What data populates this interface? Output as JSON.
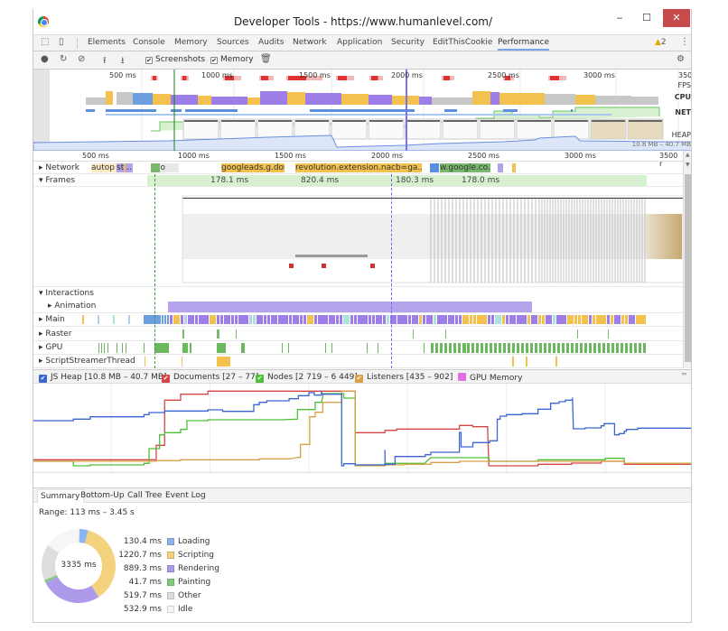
{
  "window": {
    "title": "Developer Tools - https://www.humanlevel.com/",
    "minimize": "‒",
    "maximize": "☐",
    "close": "✕"
  },
  "tabs": [
    {
      "label": "Elements"
    },
    {
      "label": "Console"
    },
    {
      "label": "Memory"
    },
    {
      "label": "Sources"
    },
    {
      "label": "Audits"
    },
    {
      "label": "Network"
    },
    {
      "label": "Application"
    },
    {
      "label": "Security"
    },
    {
      "label": "EditThisCookie"
    },
    {
      "label": "Performance",
      "active": true
    }
  ],
  "warnings": {
    "icon": "warning-icon",
    "count": "2"
  },
  "toolbar": {
    "screenshots_label": "Screenshots",
    "screenshots_checked": true,
    "memory_label": "Memory",
    "memory_checked": true
  },
  "overview": {
    "ticks": [
      "500 ms",
      "1000 ms",
      "1500 ms",
      "2000 ms",
      "2500 ms",
      "3000 ms",
      "3500"
    ],
    "labels": {
      "fps": "FPS",
      "cpu": "CPU",
      "net": "NET",
      "heap": "HEAP"
    },
    "heap_range": "10.8 MB – 40.7 MB"
  },
  "ruler": {
    "ticks": [
      "500 ms",
      "1000 ms",
      "1500 ms",
      "2000 ms",
      "2500 ms",
      "3000 ms",
      "3500 r"
    ]
  },
  "tracks": {
    "network": "Network",
    "frames": "Frames",
    "interactions": "Interactions",
    "animation": "Animation",
    "main": "Main",
    "raster": "Raster",
    "gpu": "GPU",
    "script_streamer": "ScriptStreamerThread"
  },
  "network_items": [
    {
      "label": "autop"
    },
    {
      "label": "st..."
    },
    {
      "label": "ico"
    },
    {
      "label": "googleads.g.doubl"
    },
    {
      "label": "revolution.extension.navigat"
    },
    {
      "label": "cb=ga..."
    },
    {
      "label": "w.google.co..."
    }
  ],
  "frames": [
    {
      "label": "178.1 ms"
    },
    {
      "label": "820.4 ms"
    },
    {
      "label": "180.3 ms"
    },
    {
      "label": "178.0 ms"
    }
  ],
  "memory_legend": [
    {
      "label": "JS Heap [10.8 MB – 40.7 MB]",
      "color": "#3a66d4",
      "checked": true
    },
    {
      "label": "Documents [27 – 77]",
      "color": "#d64545",
      "checked": true
    },
    {
      "label": "Nodes [2 719 – 6 449]",
      "color": "#4fbf3a",
      "checked": true
    },
    {
      "label": "Listeners [435 – 902]",
      "color": "#d8a047",
      "checked": true
    },
    {
      "label": "GPU Memory",
      "color": "#e070e0",
      "checked": false
    }
  ],
  "bottom_tabs": [
    {
      "label": "Summary",
      "active": true
    },
    {
      "label": "Bottom-Up"
    },
    {
      "label": "Call Tree"
    },
    {
      "label": "Event Log"
    }
  ],
  "summary": {
    "range": "Range: 113 ms – 3.45 s",
    "total": "3335 ms",
    "items": [
      {
        "value": "130.4 ms",
        "label": "Loading",
        "color": "#8cb4ee",
        "ms": 130.4
      },
      {
        "value": "1220.7 ms",
        "label": "Scripting",
        "color": "#f2d27c",
        "ms": 1220.7
      },
      {
        "value": "889.3 ms",
        "label": "Rendering",
        "color": "#ae9aeb",
        "ms": 889.3
      },
      {
        "value": "41.7 ms",
        "label": "Painting",
        "color": "#84c97d",
        "ms": 41.7
      },
      {
        "value": "519.7 ms",
        "label": "Other",
        "color": "#dddddd",
        "ms": 519.7
      },
      {
        "value": "532.9 ms",
        "label": "Idle",
        "color": "#f6f6f6",
        "ms": 532.9
      }
    ]
  }
}
